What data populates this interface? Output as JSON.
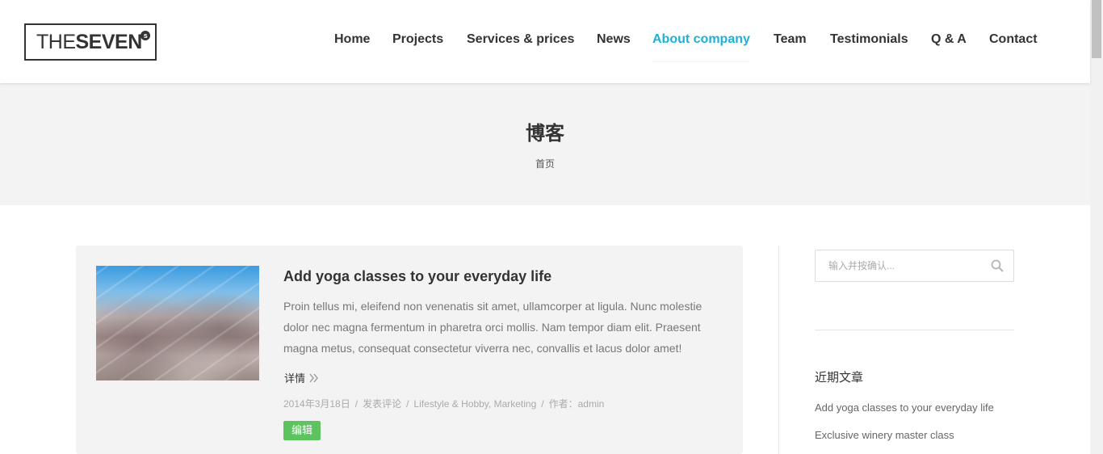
{
  "logo": {
    "thin": "THE",
    "bold": "SEVEN",
    "sup": "s"
  },
  "nav": {
    "items": [
      {
        "label": "Home",
        "active": false
      },
      {
        "label": "Projects",
        "active": false
      },
      {
        "label": "Services & prices",
        "active": false
      },
      {
        "label": "News",
        "active": false
      },
      {
        "label": "About company",
        "active": true
      },
      {
        "label": "Team",
        "active": false
      },
      {
        "label": "Testimonials",
        "active": false
      },
      {
        "label": "Q & A",
        "active": false
      },
      {
        "label": "Contact",
        "active": false
      }
    ],
    "active_color": "#1eb0d6"
  },
  "page": {
    "title": "博客",
    "breadcrumb": "首页"
  },
  "post": {
    "title": "Add yoga classes to your everyday life",
    "excerpt": "Proin tellus mi, eleifend non venenatis sit amet, ullamcorper at ligula. Nunc molestie dolor nec magna fermentum in pharetra orci mollis. Nam tempor diam elit. Praesent magna metus, consequat consectetur viverra nec, convallis et lacus dolor amet!",
    "more_label": "详情",
    "meta": {
      "date": "2014年3月18日",
      "comments": "发表评论",
      "categories": "Lifestyle & Hobby, Marketing",
      "author": "作者：admin"
    },
    "edit_label": "编辑",
    "edit_color": "#5cc35f"
  },
  "sidebar": {
    "search_placeholder": "输入并按确认...",
    "recent_title": "近期文章",
    "recent_posts": [
      "Add yoga classes to your everyday life",
      "Exclusive winery master class"
    ]
  }
}
